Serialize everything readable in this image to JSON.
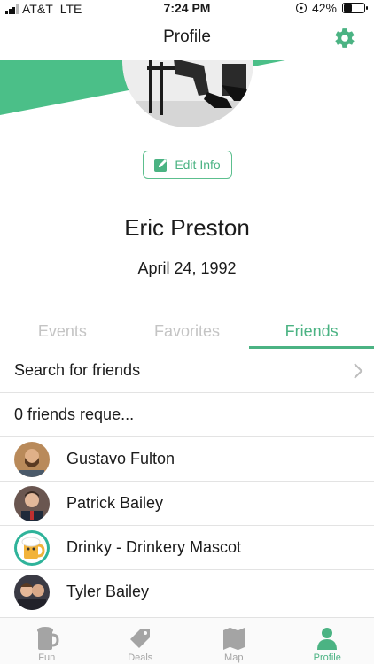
{
  "status_bar": {
    "carrier": "AT&T",
    "network": "LTE",
    "time": "7:24 PM",
    "battery": "42%",
    "battery_level": 0.42
  },
  "header": {
    "title": "Profile",
    "settings_icon": "gear-icon"
  },
  "profile": {
    "edit_label": "Edit Info",
    "name": "Eric Preston",
    "dob": "April 24, 1992"
  },
  "tabs": [
    {
      "label": "Events",
      "active": false
    },
    {
      "label": "Favorites",
      "active": false
    },
    {
      "label": "Friends",
      "active": true
    }
  ],
  "friends": {
    "search_label": "Search for friends",
    "requests_label": "0 friends reque...",
    "list": [
      {
        "name": "Gustavo Fulton"
      },
      {
        "name": "Patrick Bailey"
      },
      {
        "name": "Drinky - Drinkery Mascot"
      },
      {
        "name": "Tyler Bailey"
      }
    ]
  },
  "tabbar": [
    {
      "label": "Fun",
      "icon": "beer-mug-icon",
      "active": false
    },
    {
      "label": "Deals",
      "icon": "tag-icon",
      "active": false
    },
    {
      "label": "Map",
      "icon": "map-icon",
      "active": false
    },
    {
      "label": "Profile",
      "icon": "person-icon",
      "active": true
    }
  ],
  "colors": {
    "accent": "#4bb383",
    "inactive": "#a4a4a4"
  }
}
